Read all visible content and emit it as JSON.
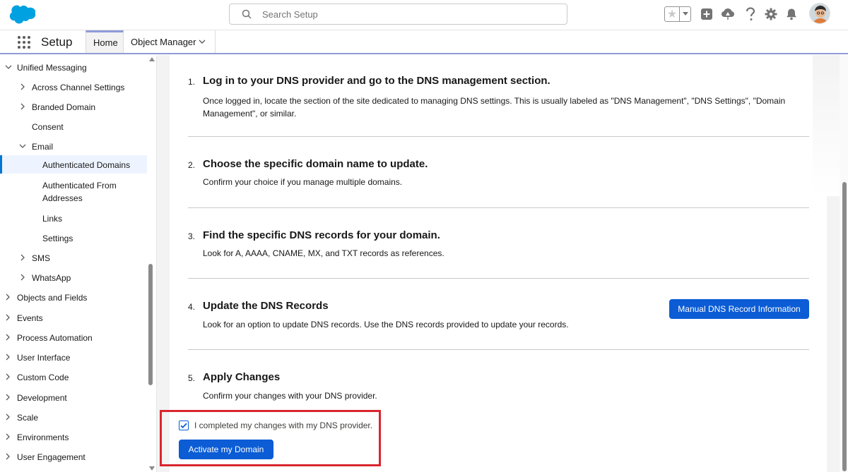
{
  "header": {
    "search_placeholder": "Search Setup",
    "icons": [
      "salesforce-cloud-logo",
      "search-icon",
      "star-icon",
      "chevron-down-icon",
      "add-icon",
      "trailhead-icon",
      "help-icon",
      "gear-icon",
      "bell-icon",
      "avatar"
    ]
  },
  "context": {
    "app_name": "Setup",
    "tabs": [
      {
        "label": "Home"
      },
      {
        "label": "Object Manager"
      }
    ]
  },
  "sidebar": {
    "items": [
      {
        "label": "Unified Messaging"
      },
      {
        "label": "Across Channel Settings"
      },
      {
        "label": "Branded Domain"
      },
      {
        "label": "Consent"
      },
      {
        "label": "Email"
      },
      {
        "label": "Authenticated Domains"
      },
      {
        "label": "Authenticated From Addresses"
      },
      {
        "label": "Links"
      },
      {
        "label": "Settings"
      },
      {
        "label": "SMS"
      },
      {
        "label": "WhatsApp"
      },
      {
        "label": "Objects and Fields"
      },
      {
        "label": "Events"
      },
      {
        "label": "Process Automation"
      },
      {
        "label": "User Interface"
      },
      {
        "label": "Custom Code"
      },
      {
        "label": "Development"
      },
      {
        "label": "Scale"
      },
      {
        "label": "Environments"
      },
      {
        "label": "User Engagement"
      }
    ]
  },
  "steps": [
    {
      "num": "1.",
      "title": "Log in to your DNS provider and go to the DNS management section.",
      "desc": "Once logged in, locate the section of the site dedicated to managing DNS settings. This is usually labeled as \"DNS Management\", \"DNS Settings\", \"Domain Management\", or similar."
    },
    {
      "num": "2.",
      "title": "Choose the specific domain name to update.",
      "desc": "Confirm your choice if you manage multiple domains."
    },
    {
      "num": "3.",
      "title": "Find the specific DNS records for your domain.",
      "desc": "Look for A, AAAA, CNAME, MX, and TXT records as references."
    },
    {
      "num": "4.",
      "title": "Update the DNS Records",
      "desc": "Look for an option to update DNS records. Use the DNS records provided to update your records."
    },
    {
      "num": "5.",
      "title": "Apply Changes",
      "desc": "Confirm your changes with your DNS provider."
    }
  ],
  "buttons": {
    "manual_dns": "Manual DNS Record Information",
    "activate": "Activate my Domain"
  },
  "confirm": {
    "label": "I completed my changes with my DNS provider.",
    "checked": true
  },
  "colors": {
    "brand_blue": "#0b5cd5",
    "highlight_red": "#d9262f",
    "tab_accent": "#8f9bd8"
  }
}
